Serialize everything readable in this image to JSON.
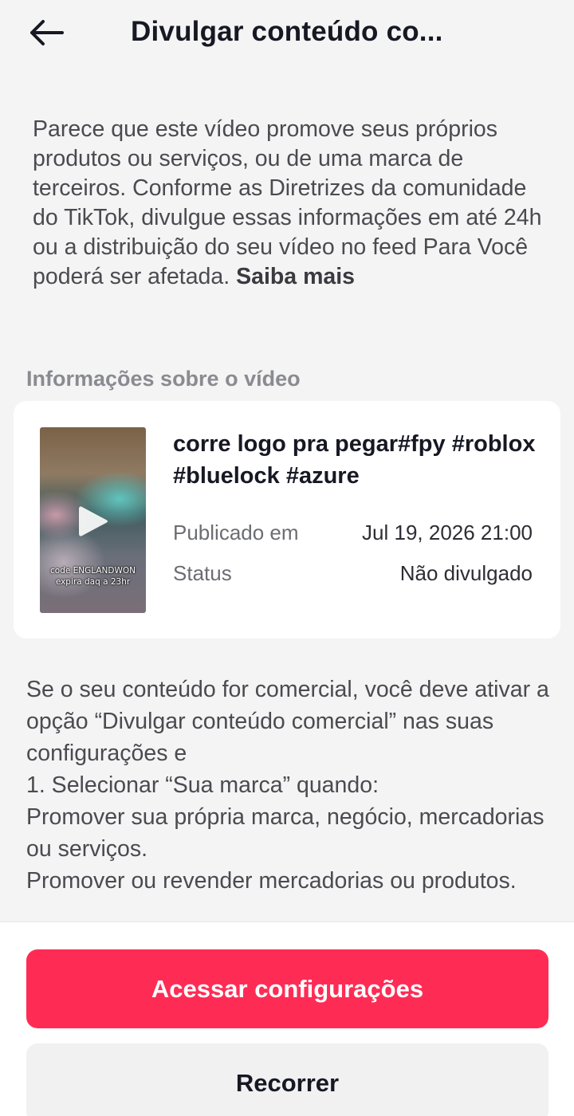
{
  "header": {
    "title": "Divulgar conteúdo co...",
    "back_icon": "arrow-left-icon"
  },
  "intro": {
    "text": "Parece que este vídeo promove seus próprios produtos ou serviços, ou de uma marca de terceiros. Conforme as Diretrizes da comunidade do TikTok, divulgue essas informações em até 24h ou a distribuição do seu vídeo no feed Para Você poderá ser afetada.",
    "link_label": "Saiba mais"
  },
  "video_section": {
    "label": "Informações sobre o vídeo",
    "thumbnail": {
      "caption_line1": "code ENGLANDWON",
      "caption_line2": "expira daq a 23hr",
      "play_icon": "play-icon"
    },
    "caption": "corre logo pra pegar#fpy #roblox #bluelock #azure",
    "published_label": "Publicado em",
    "published_value": "Jul 19, 2026 21:00",
    "status_label": "Status",
    "status_value": "Não divulgado"
  },
  "body": {
    "paragraphs": [
      "Se o seu conteúdo for comercial, você deve ativar a opção “Divulgar conteúdo comercial” nas suas configurações e",
      "1. Selecionar “Sua marca” quando:",
      "Promover sua própria marca, negócio, mercadorias ou serviços.",
      "Promover ou revender mercadorias ou produtos."
    ]
  },
  "actions": {
    "primary_label": "Acessar configurações",
    "secondary_label": "Recorrer"
  },
  "colors": {
    "accent": "#fe2c55",
    "background": "#f4f4f4",
    "card": "#ffffff"
  }
}
